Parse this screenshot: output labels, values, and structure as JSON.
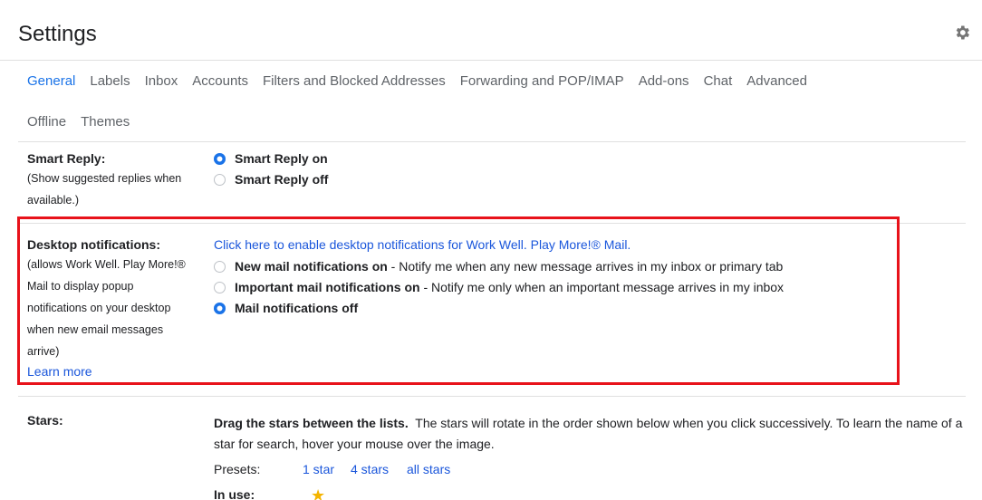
{
  "header": {
    "title": "Settings",
    "gear_icon": "gear-icon"
  },
  "tabs": {
    "row1": [
      "General",
      "Labels",
      "Inbox",
      "Accounts",
      "Filters and Blocked Addresses",
      "Forwarding and POP/IMAP",
      "Add-ons",
      "Chat",
      "Advanced"
    ],
    "row2": [
      "Offline",
      "Themes"
    ],
    "active": "General"
  },
  "smart_reply": {
    "title": "Smart Reply:",
    "desc": [
      "(Show suggested replies when",
      "available.)"
    ],
    "options": [
      {
        "label": "Smart Reply on",
        "selected": true
      },
      {
        "label": "Smart Reply off",
        "selected": false
      }
    ]
  },
  "desktop_notifications": {
    "title": "Desktop notifications:",
    "desc": [
      "(allows Work Well. Play More!®",
      "Mail to display popup",
      "notifications on your desktop",
      "when new email messages",
      "arrive)"
    ],
    "learn_more": "Learn more",
    "enable_link": "Click here to enable desktop notifications for Work Well. Play More!® Mail.",
    "options": [
      {
        "bold": "New mail notifications on",
        "rest": " - Notify me when any new message arrives in my inbox or primary tab",
        "selected": false
      },
      {
        "bold": "Important mail notifications on",
        "rest": " - Notify me only when an important message arrives in my inbox",
        "selected": false
      },
      {
        "bold": "Mail notifications off",
        "rest": "",
        "selected": true
      }
    ],
    "highlight_color": "#e8121a"
  },
  "stars": {
    "title": "Stars:",
    "instruction_bold": "Drag the stars between the lists.",
    "instruction_rest": "  The stars will rotate in the order shown below when you click successively. To learn the name of a star for search, hover your mouse over the image.",
    "presets_label": "Presets:",
    "presets": [
      "1 star",
      "4 stars",
      "all stars"
    ],
    "in_use_label": "In use:",
    "in_use_icon": "yellow-star-icon"
  },
  "colors": {
    "accent": "#1a73e8",
    "link": "#1a56db",
    "star": "#f4b400"
  }
}
